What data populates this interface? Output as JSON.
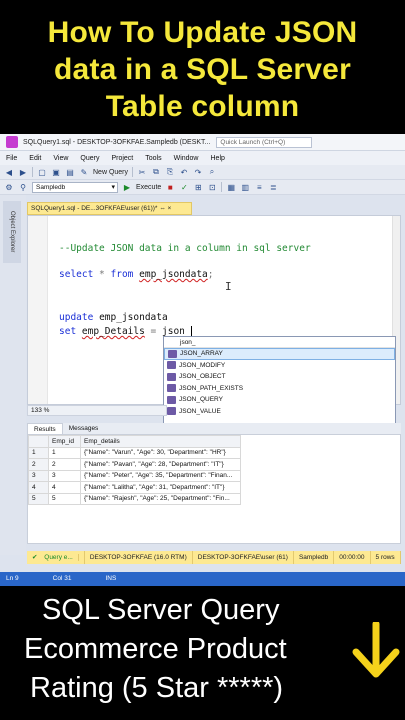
{
  "banner_top": {
    "line1": "How To Update JSON",
    "line2": "data in a SQL Server",
    "line3": "Table column"
  },
  "window": {
    "title": "SQLQuery1.sql - DESKTOP-3OFKFAE.Sampledb (DESKT...",
    "quick_launch_placeholder": "Quick Launch (Ctrl+Q)"
  },
  "menu": [
    "File",
    "Edit",
    "View",
    "Query",
    "Project",
    "Tools",
    "Window",
    "Help"
  ],
  "toolbar": {
    "new_query_label": "New Query",
    "database": "Sampledb",
    "execute_label": "Execute"
  },
  "left_strip_label": "Object Explorer",
  "doc_tab": "SQLQuery1.sql - DE...3OFKFAE\\user (61))*  ⇔ ×",
  "editor": {
    "comment": "--Update JSON data in a column in sql server",
    "select_kw": "select",
    "star": " * ",
    "from_kw": "from",
    "table1": "emp_jsondata",
    "semicolon": ";",
    "update_kw": "update",
    "table2": "emp_jsondata",
    "set_kw": "set",
    "column": "emp_Details",
    "equals": " = ",
    "typed": "json_"
  },
  "intellisense": {
    "header": "json_",
    "items": [
      "JSON_ARRAY",
      "JSON_MODIFY",
      "JSON_OBJECT",
      "JSON_PATH_EXISTS",
      "JSON_QUERY",
      "JSON_VALUE"
    ]
  },
  "zoom": "133 %",
  "results_tabs": [
    "Results",
    "Messages"
  ],
  "grid": {
    "columns": [
      "Emp_id",
      "Emp_details"
    ],
    "rows": [
      [
        "1",
        "1",
        "{\"Name\": \"Varun\", \"Age\": 30, \"Department\": \"HR\"}"
      ],
      [
        "2",
        "2",
        "{\"Name\": \"Pavan\", \"Age\": 28, \"Department\": \"IT\"}"
      ],
      [
        "3",
        "3",
        "{\"Name\": \"Peter\", \"Age\": 35, \"Department\": \"Finan..."
      ],
      [
        "4",
        "4",
        "{\"Name\": \"Lalitha\", \"Age\": 31, \"Department\": \"IT\"}"
      ],
      [
        "5",
        "5",
        "{\"Name\": \"Rajesh\", \"Age\": 25, \"Department\": \"Fin..."
      ]
    ]
  },
  "status": {
    "query": "Query e...",
    "server": "DESKTOP-3OFKFAE (16.0 RTM)",
    "user": "DESKTOP-3OFKFAE\\user (61)",
    "db": "Sampledb",
    "time": "00:00:00",
    "rows": "5 rows"
  },
  "bottombar": {
    "ln": "Ln 9",
    "col": "Col 31",
    "ins": "INS"
  },
  "banner_bottom": {
    "line1": "SQL Server Query",
    "line2": "Ecommerce Product",
    "line3": "Rating (5 Star *****)"
  },
  "colors": {
    "banner_yellow": "#f5e83b",
    "arrow_yellow": "#f5d21b",
    "status_yellow": "#fde992"
  }
}
